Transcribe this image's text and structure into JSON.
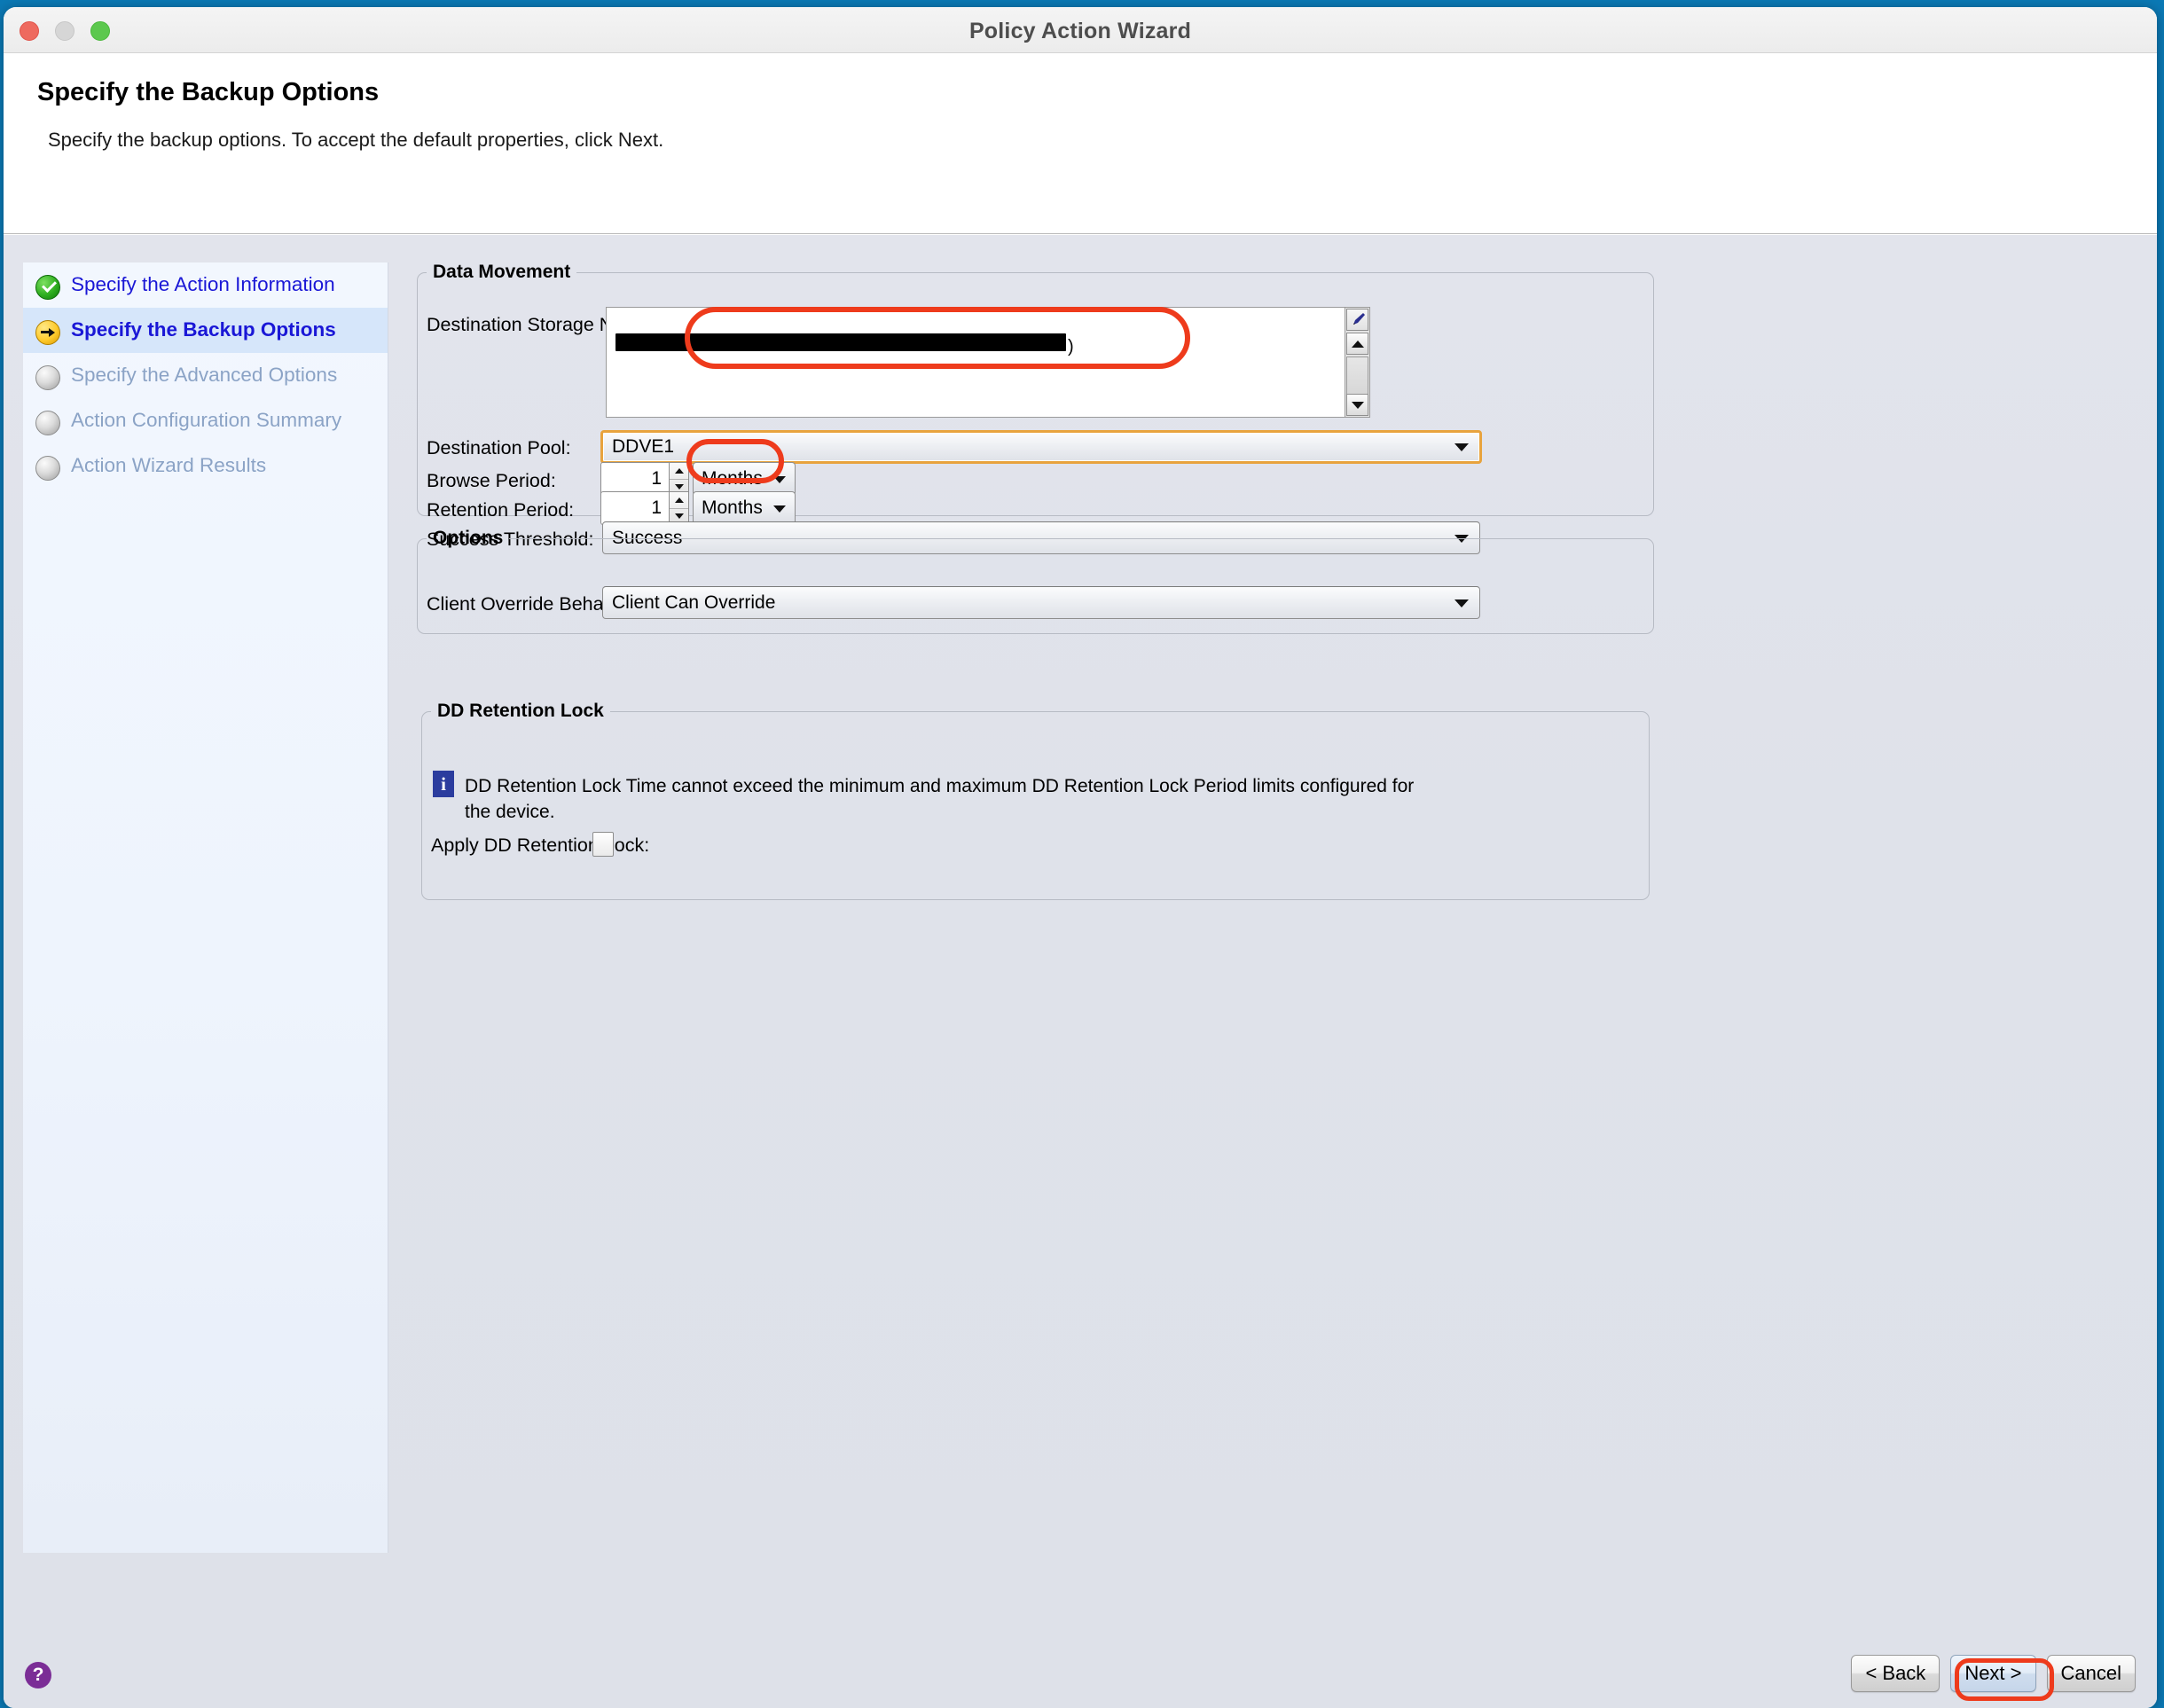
{
  "window": {
    "title": "Policy Action Wizard",
    "traffic_lights": [
      "close-button",
      "minimize-button",
      "maximize-button"
    ]
  },
  "header": {
    "title": "Specify the Backup Options",
    "subtitle": "Specify the backup options. To accept the default properties, click Next."
  },
  "sidebar": {
    "steps": [
      {
        "label": "Specify the Action Information",
        "state": "done"
      },
      {
        "label": "Specify the Backup Options",
        "state": "current"
      },
      {
        "label": "Specify the Advanced Options",
        "state": "pending"
      },
      {
        "label": "Action Configuration Summary",
        "state": "pending"
      },
      {
        "label": "Action Wizard Results",
        "state": "pending"
      }
    ]
  },
  "data_movement": {
    "legend": "Data Movement",
    "destination_storage_node": {
      "label": "Destination Storage Node:",
      "value": ")",
      "redacted": true
    },
    "destination_pool": {
      "label": "Destination Pool:",
      "value": "DDVE1",
      "focused": true
    },
    "browse_period": {
      "label": "Browse Period:",
      "value": "1",
      "unit": "Months"
    },
    "retention_period": {
      "label": "Retention Period:",
      "value": "1",
      "unit": "Months"
    },
    "success_threshold": {
      "label": "Success Threshold:",
      "value": "Success"
    }
  },
  "options": {
    "legend": "Options",
    "client_override_behavior": {
      "label": "Client Override Behavior:",
      "value": "Client Can Override"
    }
  },
  "dd_retention_lock": {
    "legend": "DD Retention Lock",
    "info_icon": "i",
    "note": "DD Retention Lock Time cannot exceed the minimum and maximum DD Retention Lock Period limits configured for the device.",
    "apply_label": "Apply DD Retention Lock:",
    "apply_checked": false
  },
  "footer": {
    "help_label": "?",
    "back_label": "< Back",
    "next_label": "Next >",
    "cancel_label": "Cancel"
  },
  "annotations": {
    "color": "#ee3b1c",
    "targets": [
      "destination-storage-node",
      "destination-pool",
      "next-button"
    ]
  }
}
